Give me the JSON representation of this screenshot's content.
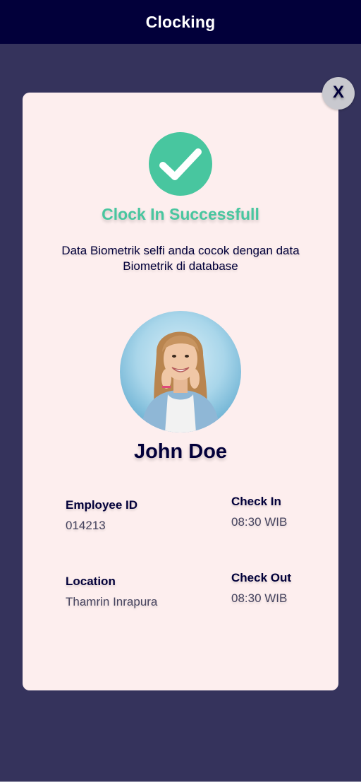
{
  "header": {
    "title": "Clocking"
  },
  "modal": {
    "close_label": "X",
    "title": "Clock In Successfull",
    "message": "Data Biometrik selfi anda cocok dengan data Biometrik di database",
    "employee_name": "John Doe",
    "fields": {
      "employee_id_label": "Employee ID",
      "employee_id_value": "014213",
      "check_in_label": "Check In",
      "check_in_value": "08:30 WIB",
      "location_label": "Location",
      "location_value": "Thamrin Inrapura",
      "check_out_label": "Check Out",
      "check_out_value": "08:30 WIB"
    }
  },
  "icons": {
    "success": "check-circle-icon",
    "close": "close-icon"
  },
  "colors": {
    "header_bg": "#02003a",
    "page_bg": "#35335c",
    "card_bg": "#fdeeee",
    "success_green": "#48c69f",
    "text_dark": "#02003a"
  }
}
